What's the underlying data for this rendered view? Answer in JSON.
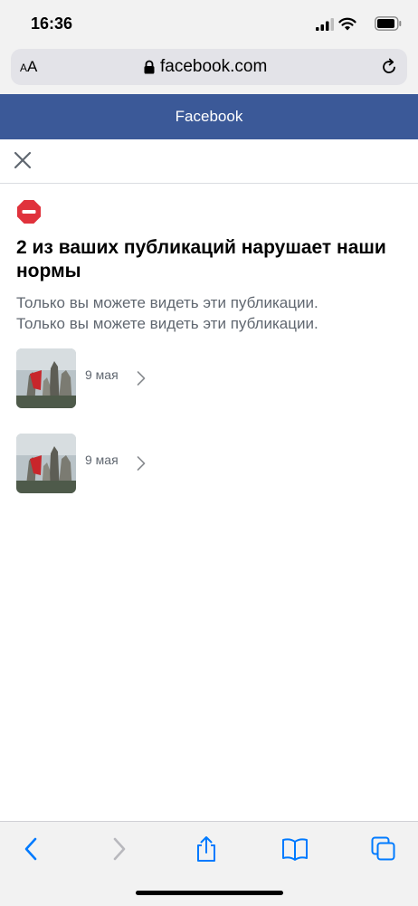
{
  "status_bar": {
    "time": "16:36"
  },
  "browser": {
    "text_size_label_small": "A",
    "text_size_label_large": "A",
    "domain": "facebook.com"
  },
  "header": {
    "title": "Facebook"
  },
  "notice": {
    "headline": "2 из ваших публикаций нарушает наши нормы",
    "description_line_1": "Только вы можете видеть эти публикации.",
    "description_line_2": "Только вы можете видеть эти публикации."
  },
  "posts": [
    {
      "date": "9 мая"
    },
    {
      "date": "9 мая"
    }
  ],
  "colors": {
    "facebook_blue": "#3b5998",
    "safari_blue": "#007aff",
    "violation_red": "#e0323c",
    "secondary_text": "#606770"
  },
  "icons": {
    "lock": "lock-icon",
    "reload": "reload-icon",
    "close": "close-icon",
    "violation": "no-entry-icon",
    "chevron": "chevron-right-icon",
    "back": "back-arrow-icon",
    "forward": "forward-arrow-icon",
    "share": "share-icon",
    "bookmarks": "bookmarks-icon",
    "tabs": "tabs-icon"
  }
}
